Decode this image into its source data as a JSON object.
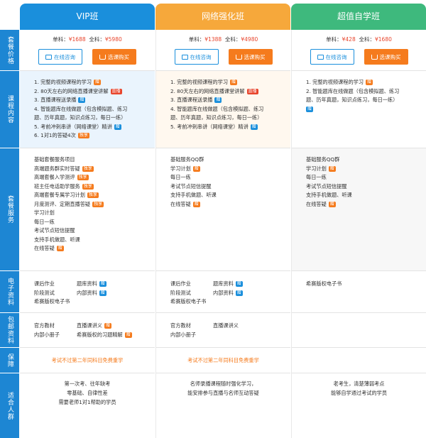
{
  "plans": {
    "vip": {
      "title": "VIP班"
    },
    "net": {
      "title": "网络强化班"
    },
    "self": {
      "title": "超值自学班"
    }
  },
  "sections": {
    "price": "套餐价格",
    "content": "课程内容",
    "service": "套餐服务",
    "ebook": "电子资料",
    "mail": "包邮资料",
    "guarantee": "保障",
    "audience": "适合人群"
  },
  "prices": {
    "vip": {
      "single_label": "单科：",
      "single": "¥1688",
      "all_label": "全科：",
      "all": "¥5980"
    },
    "net": {
      "single_label": "单科：",
      "single": "¥1388",
      "all_label": "全科：",
      "all": "¥4980"
    },
    "self": {
      "single_label": "单科：",
      "single": "¥428",
      "all_label": "全科：",
      "all": "¥1680"
    }
  },
  "buttons": {
    "consult": "在线咨询",
    "buy": "选课购买"
  },
  "content": {
    "vip": [
      "1. 完整的视频课程的学习",
      "2. 80天左右的网络直播课堂讲解",
      "3. 直播课程送录播",
      "4. 智能题库在线做题（包含模拟题、练习",
      "题、历年真题，知识点练习，每日一练）",
      "5. 考前冲刺串讲（网络课堂）精讲",
      "6. 1对1的答疑4次"
    ],
    "net": [
      "1. 完整的视频课程的学习",
      "2. 80天左右的网络直播课堂讲解",
      "3. 直播课程送录播",
      "4. 智能题库在线做题（包含模拟题、练习",
      "题、历年真题，知识点练习，每日一练）",
      "5. 考前冲刺串讲（网络课堂）精讲"
    ],
    "self": [
      "1. 完整的视频课程的学习",
      "2. 智能题库在线做题（包含模拟题、练习",
      "题、历年真题，知识点练习，每日一练）"
    ]
  },
  "tags": {
    "give": "赠",
    "live": "直播",
    "exclusive": "独享"
  },
  "service": {
    "vip": [
      "基础套餐服务项目",
      "高端题务群实时答疑",
      "高端套餐入学测评",
      "班主任电话助学服务",
      "高端套餐专属学习计划",
      "月度测评、定期直播答疑",
      "学习计划",
      "每日一练",
      "考试节点短信提醒",
      "支持手机做题、听课",
      "在线答疑"
    ],
    "net": [
      "基础服务QQ群",
      "学习计划",
      "每日一练",
      "考试节点短信提醒",
      "支持手机做题、听课",
      "在线答疑"
    ],
    "self": [
      "基础服务QQ群",
      "学习计划",
      "每日一练",
      "考试节点短信提醒",
      "支持手机做题、听课",
      "在线答疑"
    ]
  },
  "ebook": {
    "vip": [
      "课后作业",
      "题库资料",
      "阶段测试",
      "内部资料",
      "希赛版权电子书"
    ],
    "net": [
      "课后作业",
      "题库资料",
      "阶段测试",
      "内部资料",
      "希赛版权电子书"
    ],
    "self": [
      "希赛版权电子书"
    ]
  },
  "mail": {
    "vip": [
      "官方教材",
      "直播课讲义",
      "内部小册子",
      "希赛版权的习题精解"
    ],
    "net": [
      "官方教材",
      "直播课讲义",
      "内部小册子"
    ]
  },
  "guarantee": {
    "vip": "考试不过第二年同科目免费重学",
    "net": "考试不过第二年同科目免费重学"
  },
  "audience": {
    "vip": [
      "第一次考、往年缺考",
      "零基础、自律性差",
      "需要老师1对1帮助的学员"
    ],
    "net": [
      "名师录播课程随时强化学习，",
      "能安排参与直播与名师互动答疑"
    ],
    "self": [
      "老考生，清楚薄弱考点",
      "能够自学通过考试的学员"
    ]
  }
}
